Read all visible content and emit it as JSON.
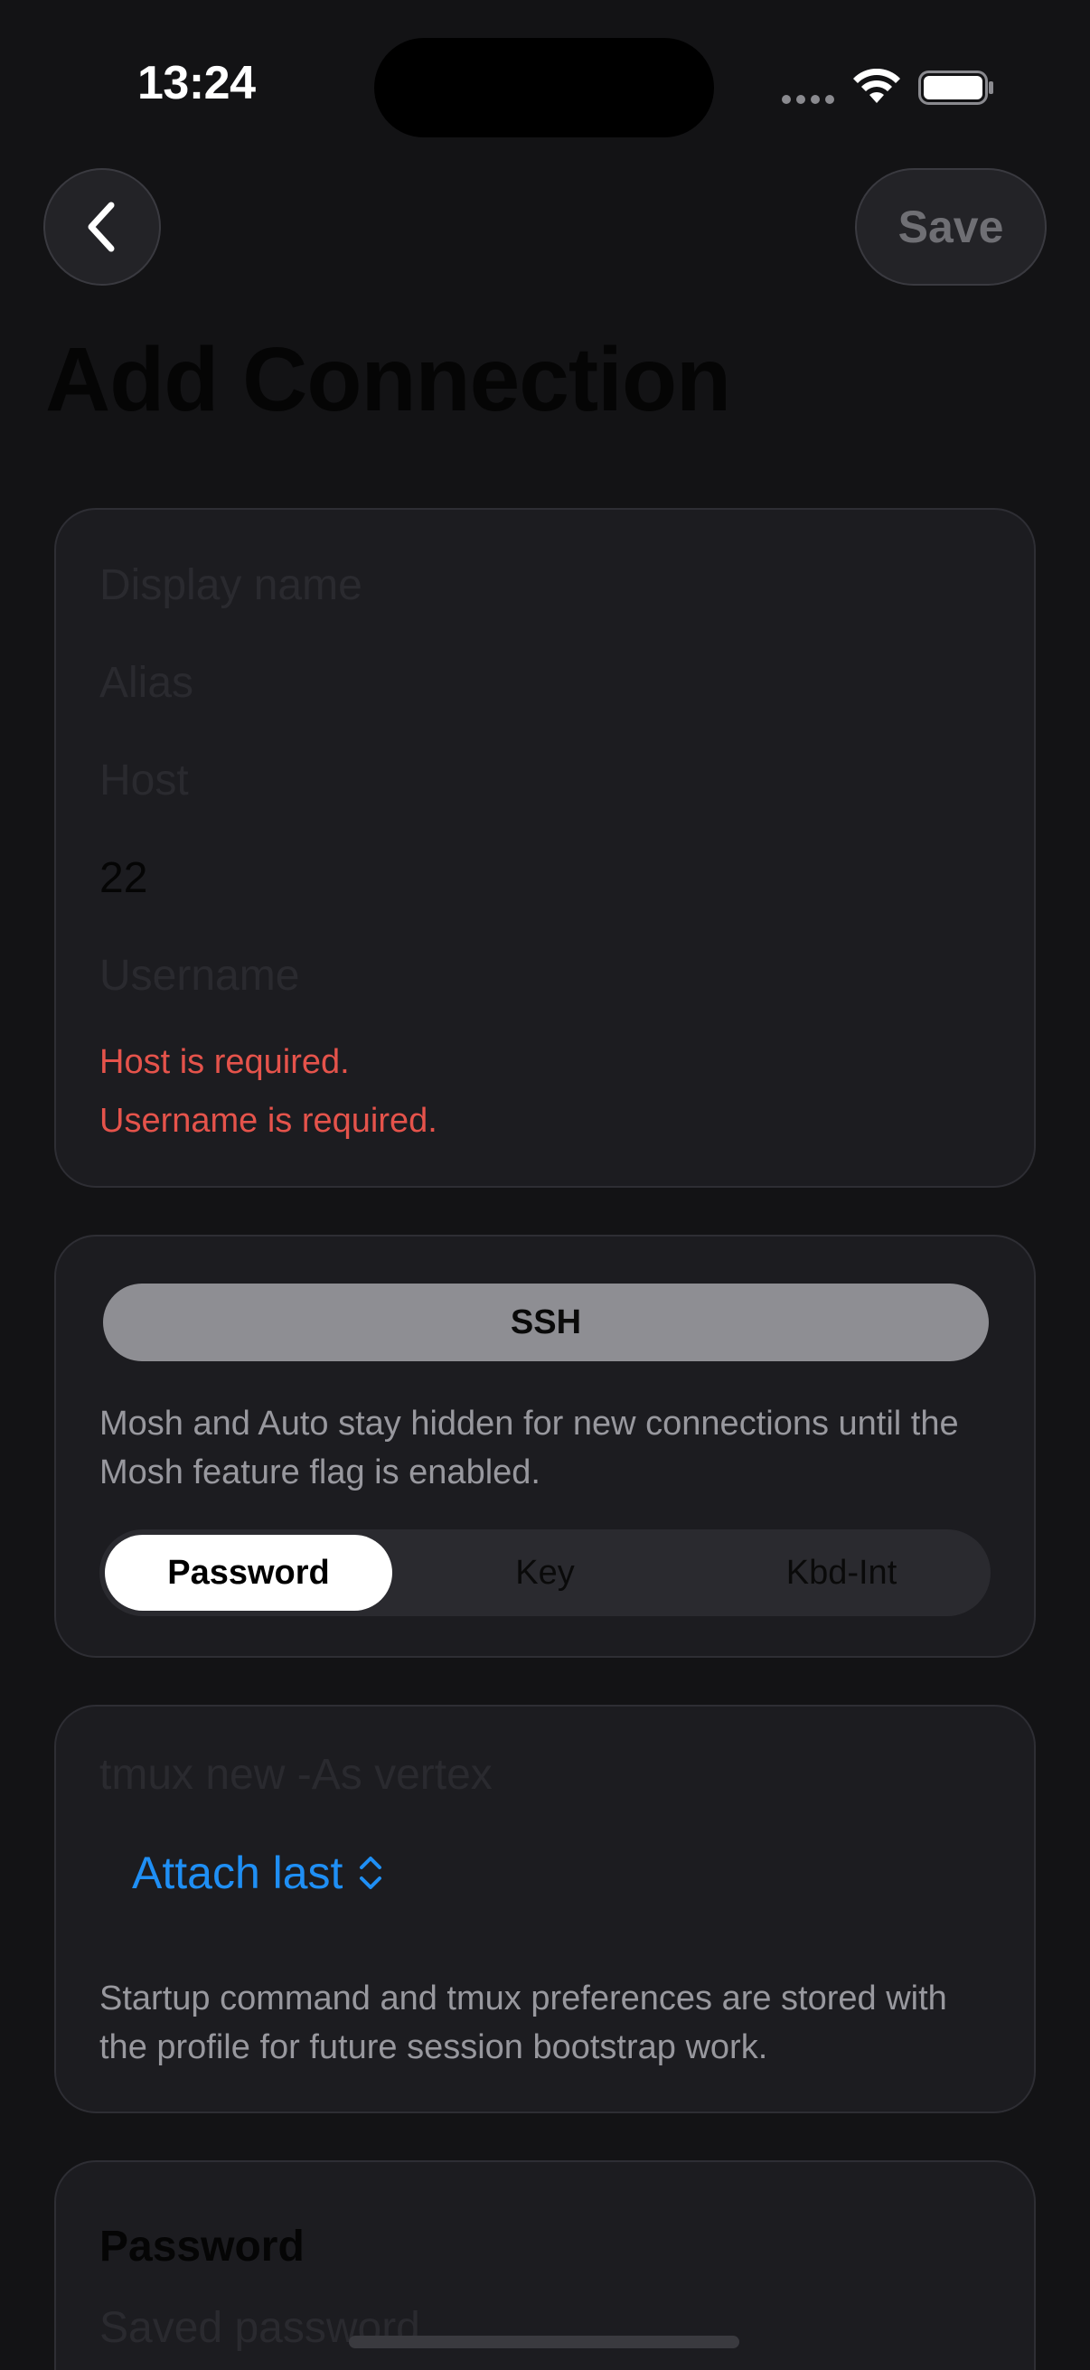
{
  "status_bar": {
    "time": "13:24"
  },
  "nav": {
    "back_icon": "chevron-left-icon",
    "save_label": "Save"
  },
  "page": {
    "title": "Add Connection"
  },
  "identity": {
    "display_name_placeholder": "Display name",
    "alias_placeholder": "Alias",
    "host_placeholder": "Host",
    "port_value": "22",
    "username_placeholder": "Username",
    "errors": [
      "Host is required.",
      "Username is required."
    ]
  },
  "protocol": {
    "selected": "SSH",
    "hint": "Mosh and Auto stay hidden for new connections until the Mosh feature flag is enabled.",
    "auth_options": [
      "Password",
      "Key",
      "Kbd-Int"
    ],
    "auth_selected": "Password"
  },
  "startup": {
    "command_placeholder": "tmux new -As vertex",
    "tmux_picker_value": "Attach last",
    "hint": "Startup command and tmux preferences are stored with the profile for future session bootstrap work."
  },
  "password_section": {
    "title": "Password",
    "field_placeholder": "Saved password"
  },
  "colors": {
    "background": "#131315",
    "card": "#1c1c20",
    "accent": "#1f8ff5",
    "error": "#e5534b"
  }
}
